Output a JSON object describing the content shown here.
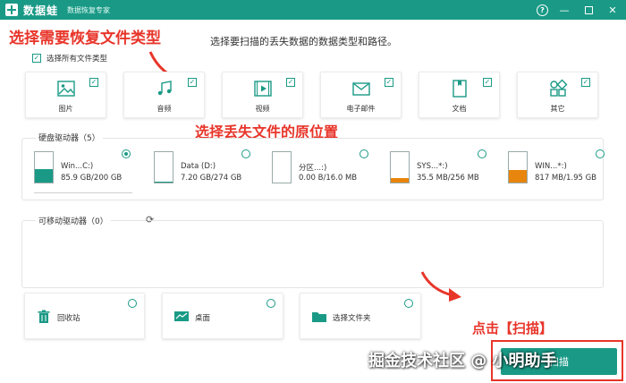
{
  "app": {
    "name": "数据蛙",
    "subtitle": "数据恢复专家"
  },
  "window": {
    "help": "?",
    "minimize": "—",
    "close": "✕"
  },
  "annotations": {
    "step1": "选择需要恢复文件类型",
    "step2": "选择丢失文件的原位置",
    "step3": "点击【扫描】"
  },
  "instruction": "选择要扫描的丢失数据的数据类型和路径。",
  "select_all": {
    "label": "选择所有文件类型",
    "checked": true
  },
  "file_types": [
    {
      "label": "图片",
      "icon": "image-icon",
      "checked": true
    },
    {
      "label": "音频",
      "icon": "music-icon",
      "checked": true
    },
    {
      "label": "视频",
      "icon": "video-icon",
      "checked": true
    },
    {
      "label": "电子邮件",
      "icon": "mail-icon",
      "checked": true
    },
    {
      "label": "文档",
      "icon": "document-icon",
      "checked": true
    },
    {
      "label": "其它",
      "icon": "other-icon",
      "checked": true
    }
  ],
  "hard_drives": {
    "title": "硬盘驱动器（5）",
    "items": [
      {
        "name": "Win...C:)",
        "size": "85.9 GB/200 GB",
        "selected": true,
        "fill": 0.43,
        "color": "#1a9a86"
      },
      {
        "name": "Data (D:)",
        "size": "7.20 GB/274 GB",
        "selected": false,
        "fill": 0.03,
        "color": "#1a9a86"
      },
      {
        "name": "分区...:)",
        "size": "0.00  B/16.0 MB",
        "selected": false,
        "fill": 0.0,
        "color": "#e8850c"
      },
      {
        "name": "SYS...*:)",
        "size": "35.5 MB/256 MB",
        "selected": false,
        "fill": 0.14,
        "color": "#e8850c"
      },
      {
        "name": "WIN...*:)",
        "size": "817 MB/1.95 GB",
        "selected": false,
        "fill": 0.42,
        "color": "#e8850c"
      }
    ]
  },
  "removable": {
    "title": "可移动驱动器（0）"
  },
  "locations": [
    {
      "label": "回收站",
      "icon": "trash-icon"
    },
    {
      "label": "桌面",
      "icon": "desktop-icon"
    },
    {
      "label": "选择文件夹",
      "icon": "folder-icon"
    }
  ],
  "scan_button": "扫描",
  "watermark": "掘金技术社区 @ 小明助手"
}
